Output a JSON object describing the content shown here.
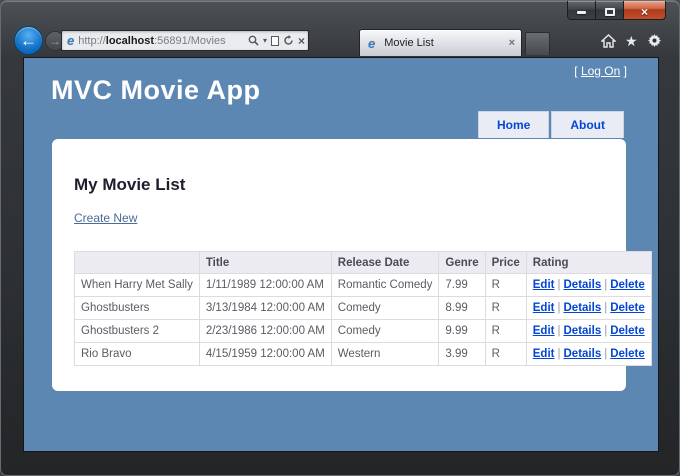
{
  "window": {
    "minimize_label": "minimize",
    "maximize_label": "maximize",
    "close_glyph": "×"
  },
  "browser": {
    "back_glyph": "←",
    "forward_glyph": "→",
    "url_prefix": "http://",
    "url_host": "localhost",
    "url_rest": ":56891/Movies",
    "caret_glyph": "▾",
    "stop_glyph": "×",
    "ie_glyph": "e",
    "tab": {
      "title": "Movie List",
      "close_glyph": "×"
    },
    "star_glyph": "★"
  },
  "page": {
    "logon": {
      "open": "[ ",
      "link": "Log On",
      "close": " ]"
    },
    "title": "MVC Movie App",
    "menu": [
      {
        "label": "Home"
      },
      {
        "label": "About"
      }
    ],
    "heading": "My Movie List",
    "create_link": "Create New",
    "table": {
      "headers": [
        "",
        "Title",
        "Release Date",
        "Genre",
        "Price",
        "Rating"
      ],
      "separator": "|",
      "actions": [
        "Edit",
        "Details",
        "Delete"
      ],
      "rows": [
        {
          "name": "When Harry Met Sally",
          "date": "1/11/1989 12:00:00 AM",
          "genre": "Romantic Comedy",
          "price": "7.99",
          "rating": "R"
        },
        {
          "name": "Ghostbusters",
          "date": "3/13/1984 12:00:00 AM",
          "genre": "Comedy",
          "price": "8.99",
          "rating": "R"
        },
        {
          "name": "Ghostbusters 2",
          "date": "2/23/1986 12:00:00 AM",
          "genre": "Comedy",
          "price": "9.99",
          "rating": "R"
        },
        {
          "name": "Rio Bravo",
          "date": "4/15/1959 12:00:00 AM",
          "genre": "Western",
          "price": "3.99",
          "rating": "R"
        }
      ]
    }
  },
  "colors": {
    "page_blue": "#5c87b2",
    "link_blue": "#0345d6",
    "muted_link": "#4a6b96",
    "table_header_bg": "#ebebf1",
    "close_button_red": "#b13a1d"
  }
}
